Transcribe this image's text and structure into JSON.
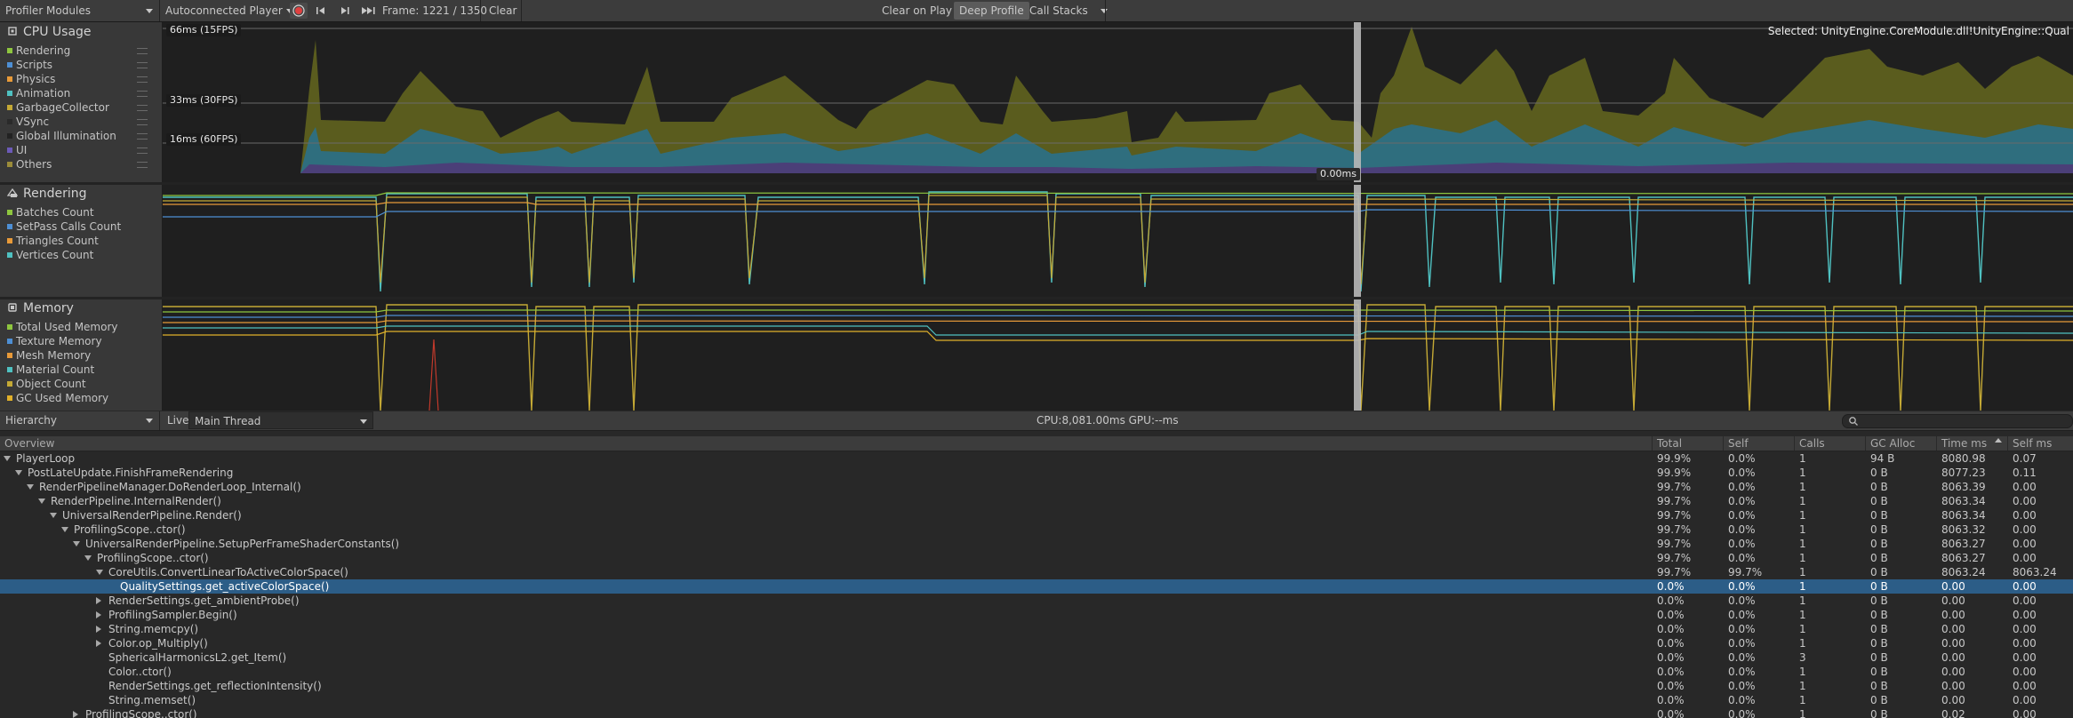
{
  "toolbar": {
    "modules_label": "Profiler Modules",
    "target_label": "Autoconnected Player",
    "frame_label": "Frame: 1221 / 1350",
    "clear_label": "Clear",
    "clear_on_play_label": "Clear on Play",
    "deep_profile_label": "Deep Profile",
    "call_stacks_label": "Call Stacks"
  },
  "cpu": {
    "title": "CPU Usage",
    "legend": [
      {
        "label": "Rendering",
        "color": "#8ec63f"
      },
      {
        "label": "Scripts",
        "color": "#4e8fd4"
      },
      {
        "label": "Physics",
        "color": "#e89a39"
      },
      {
        "label": "Animation",
        "color": "#4fc1c1"
      },
      {
        "label": "GarbageCollector",
        "color": "#c4a935"
      },
      {
        "label": "VSync",
        "color": "#2a2a2a"
      },
      {
        "label": "Global Illumination",
        "color": "#222222"
      },
      {
        "label": "UI",
        "color": "#6c5ab8"
      },
      {
        "label": "Others",
        "color": "#9b8c3a"
      }
    ],
    "fps_labels": [
      "66ms (15FPS)",
      "33ms (30FPS)",
      "16ms (60FPS)"
    ],
    "selected_ms": "0.00ms",
    "selected_text": "Selected: UnityEngine.CoreModule.dll!UnityEngine::Qual"
  },
  "rendering": {
    "title": "Rendering",
    "legend": [
      {
        "label": "Batches Count",
        "color": "#8ec63f"
      },
      {
        "label": "SetPass Calls Count",
        "color": "#4e8fd4"
      },
      {
        "label": "Triangles Count",
        "color": "#e89a39"
      },
      {
        "label": "Vertices Count",
        "color": "#4fc1c1"
      }
    ]
  },
  "memory": {
    "title": "Memory",
    "legend": [
      {
        "label": "Total Used Memory",
        "color": "#8ec63f"
      },
      {
        "label": "Texture Memory",
        "color": "#4e8fd4"
      },
      {
        "label": "Mesh Memory",
        "color": "#e89a39"
      },
      {
        "label": "Material Count",
        "color": "#4fc1c1"
      },
      {
        "label": "Object Count",
        "color": "#c4a935"
      },
      {
        "label": "GC Used Memory",
        "color": "#e0b02a"
      }
    ]
  },
  "hierarchy_bar": {
    "view_label": "Hierarchy",
    "live_label": "Live",
    "thread_label": "Main Thread",
    "cpu_gpu_label": "CPU:8,081.00ms   GPU:--ms"
  },
  "table": {
    "headers": [
      "Overview",
      "Total",
      "Self",
      "Calls",
      "GC Alloc",
      "Time ms",
      "Self ms"
    ],
    "rows": [
      {
        "name": "PlayerLoop",
        "depth": 0,
        "expander": "open",
        "total": "99.9%",
        "self": "0.0%",
        "calls": "1",
        "gc": "94 B",
        "time": "8080.98",
        "selfms": "0.07"
      },
      {
        "name": "PostLateUpdate.FinishFrameRendering",
        "depth": 1,
        "expander": "open",
        "total": "99.9%",
        "self": "0.0%",
        "calls": "1",
        "gc": "0 B",
        "time": "8077.23",
        "selfms": "0.11"
      },
      {
        "name": "RenderPipelineManager.DoRenderLoop_Internal()",
        "depth": 2,
        "expander": "open",
        "total": "99.7%",
        "self": "0.0%",
        "calls": "1",
        "gc": "0 B",
        "time": "8063.39",
        "selfms": "0.00"
      },
      {
        "name": "RenderPipeline.InternalRender()",
        "depth": 3,
        "expander": "open",
        "total": "99.7%",
        "self": "0.0%",
        "calls": "1",
        "gc": "0 B",
        "time": "8063.34",
        "selfms": "0.00"
      },
      {
        "name": "UniversalRenderPipeline.Render()",
        "depth": 4,
        "expander": "open",
        "total": "99.7%",
        "self": "0.0%",
        "calls": "1",
        "gc": "0 B",
        "time": "8063.34",
        "selfms": "0.00"
      },
      {
        "name": "ProfilingScope..ctor()",
        "depth": 5,
        "expander": "open",
        "total": "99.7%",
        "self": "0.0%",
        "calls": "1",
        "gc": "0 B",
        "time": "8063.32",
        "selfms": "0.00"
      },
      {
        "name": "UniversalRenderPipeline.SetupPerFrameShaderConstants()",
        "depth": 6,
        "expander": "open",
        "total": "99.7%",
        "self": "0.0%",
        "calls": "1",
        "gc": "0 B",
        "time": "8063.27",
        "selfms": "0.00"
      },
      {
        "name": "ProfilingScope..ctor()",
        "depth": 7,
        "expander": "open",
        "total": "99.7%",
        "self": "0.0%",
        "calls": "1",
        "gc": "0 B",
        "time": "8063.27",
        "selfms": "0.00"
      },
      {
        "name": "CoreUtils.ConvertLinearToActiveColorSpace()",
        "depth": 8,
        "expander": "open",
        "total": "99.7%",
        "self": "99.7%",
        "calls": "1",
        "gc": "0 B",
        "time": "8063.24",
        "selfms": "8063.24"
      },
      {
        "name": "QualitySettings.get_activeColorSpace()",
        "depth": 9,
        "expander": "none",
        "total": "0.0%",
        "self": "0.0%",
        "calls": "1",
        "gc": "0 B",
        "time": "0.00",
        "selfms": "0.00",
        "selected": true
      },
      {
        "name": "RenderSettings.get_ambientProbe()",
        "depth": 8,
        "expander": "closed",
        "total": "0.0%",
        "self": "0.0%",
        "calls": "1",
        "gc": "0 B",
        "time": "0.00",
        "selfms": "0.00"
      },
      {
        "name": "ProfilingSampler.Begin()",
        "depth": 8,
        "expander": "closed",
        "total": "0.0%",
        "self": "0.0%",
        "calls": "1",
        "gc": "0 B",
        "time": "0.00",
        "selfms": "0.00"
      },
      {
        "name": "String.memcpy()",
        "depth": 8,
        "expander": "closed",
        "total": "0.0%",
        "self": "0.0%",
        "calls": "1",
        "gc": "0 B",
        "time": "0.00",
        "selfms": "0.00"
      },
      {
        "name": "Color.op_Multiply()",
        "depth": 8,
        "expander": "closed",
        "total": "0.0%",
        "self": "0.0%",
        "calls": "1",
        "gc": "0 B",
        "time": "0.00",
        "selfms": "0.00"
      },
      {
        "name": "SphericalHarmonicsL2.get_Item()",
        "depth": 8,
        "expander": "none",
        "total": "0.0%",
        "self": "0.0%",
        "calls": "3",
        "gc": "0 B",
        "time": "0.00",
        "selfms": "0.00"
      },
      {
        "name": "Color..ctor()",
        "depth": 8,
        "expander": "none",
        "total": "0.0%",
        "self": "0.0%",
        "calls": "1",
        "gc": "0 B",
        "time": "0.00",
        "selfms": "0.00"
      },
      {
        "name": "RenderSettings.get_reflectionIntensity()",
        "depth": 8,
        "expander": "none",
        "total": "0.0%",
        "self": "0.0%",
        "calls": "1",
        "gc": "0 B",
        "time": "0.00",
        "selfms": "0.00"
      },
      {
        "name": "String.memset()",
        "depth": 8,
        "expander": "none",
        "total": "0.0%",
        "self": "0.0%",
        "calls": "1",
        "gc": "0 B",
        "time": "0.00",
        "selfms": "0.00"
      },
      {
        "name": "ProfilingScope..ctor()",
        "depth": 6,
        "expander": "closed",
        "total": "0.0%",
        "self": "0.0%",
        "calls": "1",
        "gc": "0 B",
        "time": "0.02",
        "selfms": "0.00"
      }
    ]
  }
}
